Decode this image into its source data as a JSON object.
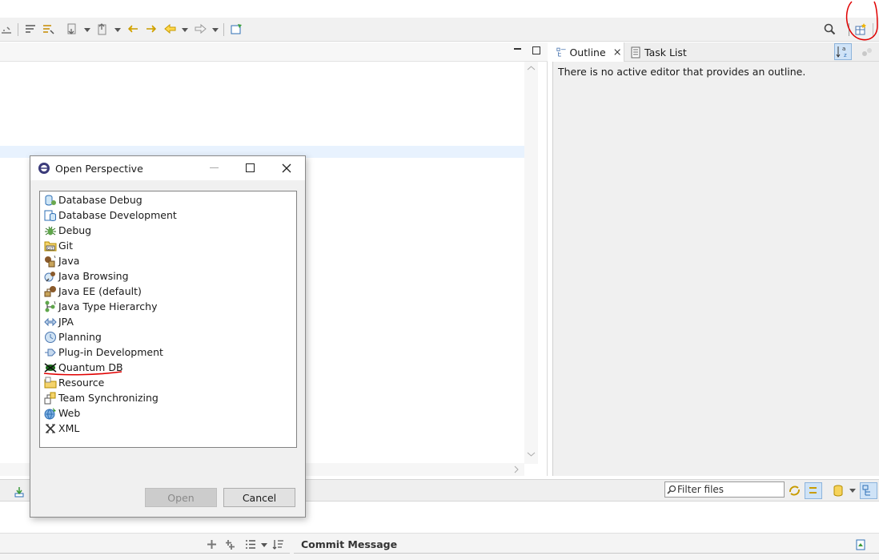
{
  "outline": {
    "tabs": [
      {
        "label": "Outline"
      },
      {
        "label": "Task List"
      }
    ],
    "message": "There is no active editor that provides an outline."
  },
  "bottom": {
    "filter_placeholder": "Filter files",
    "commit_label": "Commit Message"
  },
  "dialog": {
    "title": "Open Perspective",
    "items": [
      {
        "label": "Database Debug",
        "icon": "database-debug-icon"
      },
      {
        "label": "Database Development",
        "icon": "database-development-icon"
      },
      {
        "label": "Debug",
        "icon": "bug-icon"
      },
      {
        "label": "Git",
        "icon": "git-icon"
      },
      {
        "label": "Java",
        "icon": "java-icon"
      },
      {
        "label": "Java Browsing",
        "icon": "java-browsing-icon"
      },
      {
        "label": "Java EE (default)",
        "icon": "java-ee-icon"
      },
      {
        "label": "Java Type Hierarchy",
        "icon": "type-hierarchy-icon"
      },
      {
        "label": "JPA",
        "icon": "jpa-icon"
      },
      {
        "label": "Planning",
        "icon": "planning-icon"
      },
      {
        "label": "Plug-in Development",
        "icon": "plugin-icon"
      },
      {
        "label": "Quantum DB",
        "icon": "quantum-db-icon"
      },
      {
        "label": "Resource",
        "icon": "folder-icon"
      },
      {
        "label": "Team Synchronizing",
        "icon": "team-sync-icon"
      },
      {
        "label": "Web",
        "icon": "web-icon"
      },
      {
        "label": "XML",
        "icon": "xml-icon"
      }
    ],
    "open_label": "Open",
    "cancel_label": "Cancel"
  },
  "colors": {
    "annotation_red": "#e00000",
    "selection_blue": "#e8f2fe",
    "dialog_bg": "#f0f0f0"
  }
}
